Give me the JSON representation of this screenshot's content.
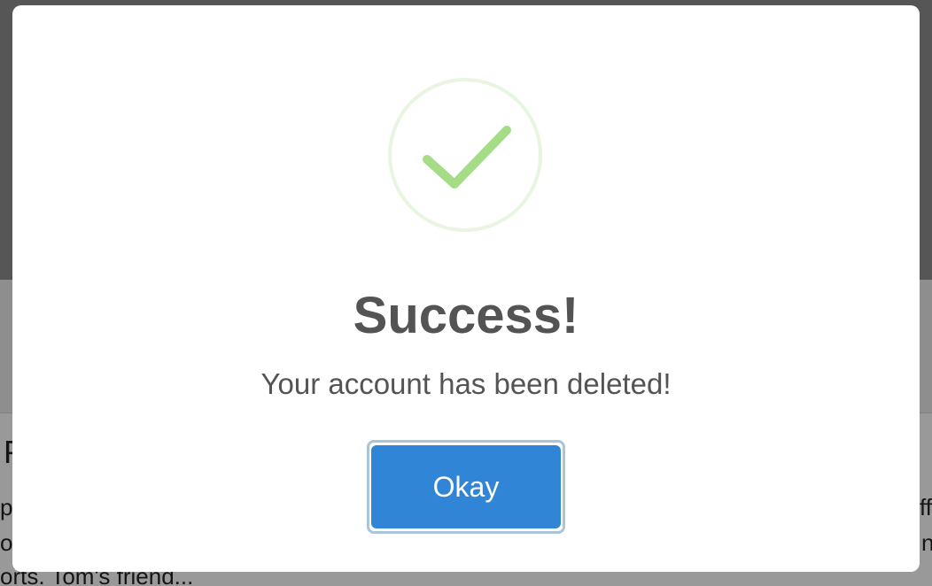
{
  "background": {
    "heading_fragment": "P",
    "line1_start": "p",
    "line1_end": "ffe",
    "line2_start": "o",
    "line2_end": "n",
    "line3": "orts. Tom's friend..."
  },
  "modal": {
    "icon": "success-check-icon",
    "title": "Success!",
    "message": "Your account has been deleted!",
    "confirm_label": "Okay"
  },
  "colors": {
    "confirm_button": "#3085d6",
    "check": "#a5dc86",
    "check_ring": "#e8f5e0",
    "text": "#545454"
  }
}
